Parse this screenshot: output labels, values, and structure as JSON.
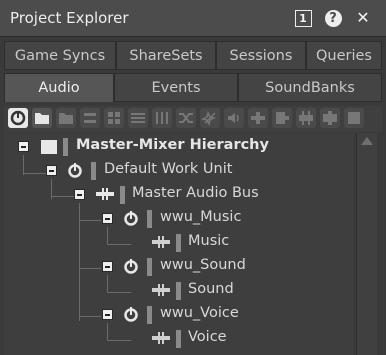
{
  "window": {
    "title": "Project Explorer",
    "help_label": "?",
    "layout_label": "1",
    "close_label": "✕"
  },
  "tabs_top": [
    {
      "label": "Game Syncs"
    },
    {
      "label": "ShareSets"
    },
    {
      "label": "Sessions"
    },
    {
      "label": "Queries"
    }
  ],
  "tabs_bottom": [
    {
      "label": "Audio",
      "active": true
    },
    {
      "label": "Events"
    },
    {
      "label": "SoundBanks"
    }
  ],
  "tree": {
    "root": "Master-Mixer Hierarchy",
    "work_unit": "Default Work Unit",
    "bus": "Master Audio Bus",
    "music_unit": "wwu_Music",
    "music": "Music",
    "sound_unit": "wwu_Sound",
    "sound": "Sound",
    "voice_unit": "wwu_Voice",
    "voice": "Voice"
  },
  "colors": {
    "background": "#3a3a3a",
    "titlebar": "#4c4c4c",
    "active_tab": "#565656",
    "text": "#dcdcdc"
  }
}
